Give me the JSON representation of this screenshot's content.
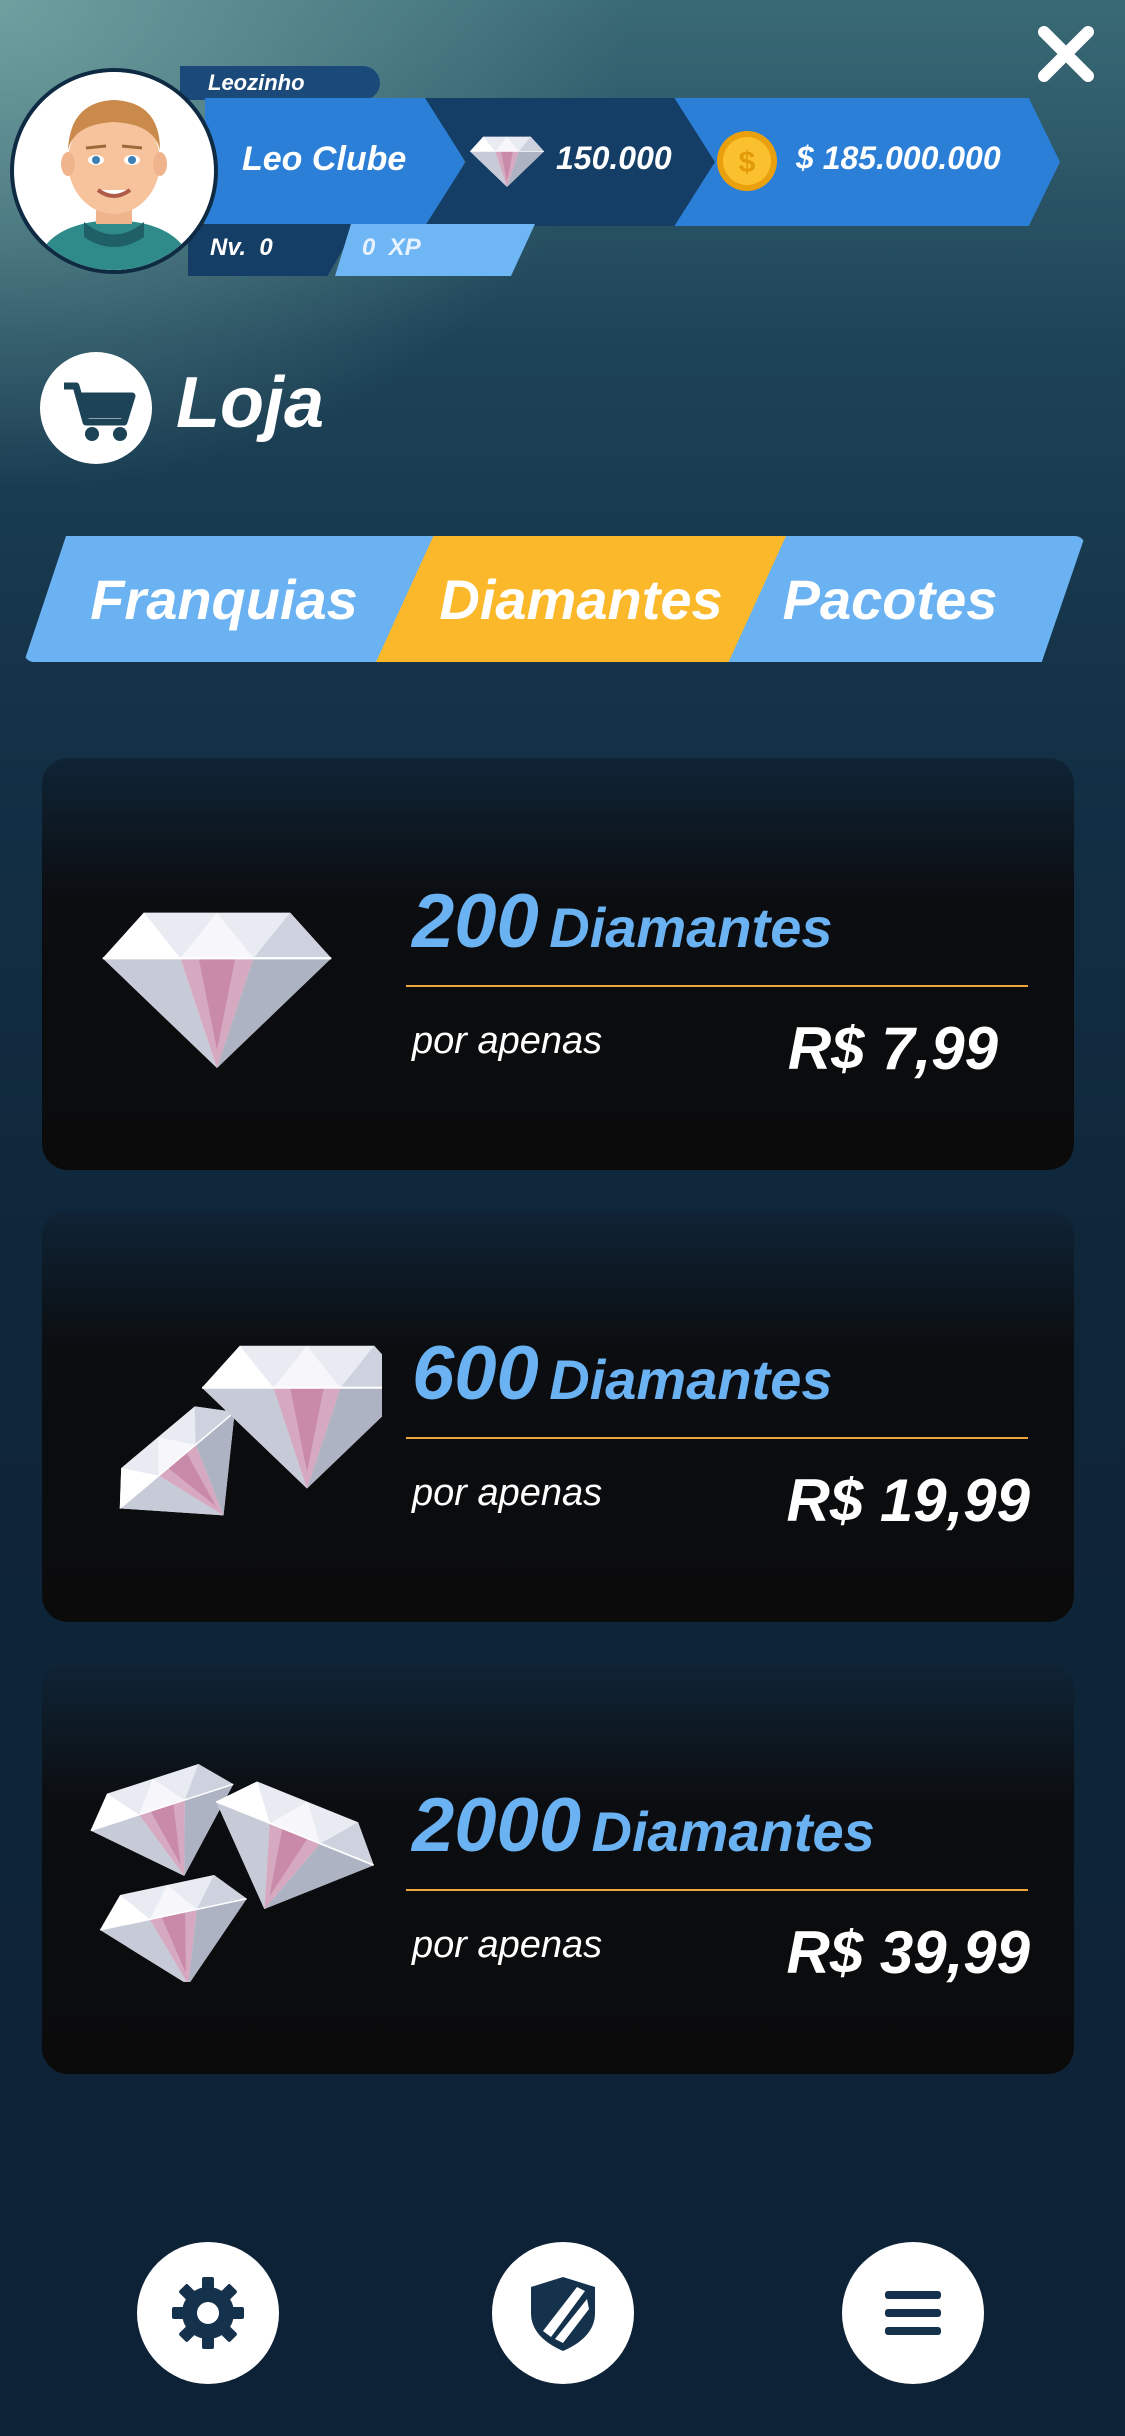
{
  "header": {
    "username": "Leozinho",
    "club_name": "Leo Clube",
    "diamonds": "150.000",
    "money": "$ 185.000.000",
    "level_label": "Nv.",
    "level_value": "0",
    "xp_value": "0",
    "xp_label": "XP"
  },
  "page": {
    "title": "Loja"
  },
  "tabs": [
    {
      "label": "Franquias",
      "active": false
    },
    {
      "label": "Diamantes",
      "active": true
    },
    {
      "label": "Pacotes",
      "active": false
    }
  ],
  "offers": [
    {
      "amount": "200",
      "unit": "Diamantes",
      "subtitle": "por apenas",
      "price": "R$ 7,99"
    },
    {
      "amount": "600",
      "unit": "Diamantes",
      "subtitle": "por apenas",
      "price": "R$ 19,99"
    },
    {
      "amount": "2000",
      "unit": "Diamantes",
      "subtitle": "por apenas",
      "price": "R$ 39,99"
    }
  ],
  "icons": {
    "close": "close-icon",
    "cart": "cart-icon",
    "diamond": "diamond-icon",
    "coin": "coin-icon",
    "settings": "gear-icon",
    "club": "shield-icon",
    "menu": "menu-icon"
  },
  "colors": {
    "accent_blue": "#6ab2f2",
    "active_tab": "#fbb82a",
    "divider": "#f0a43a",
    "header_blue": "#2c7fd6",
    "header_dark": "#143e66"
  }
}
